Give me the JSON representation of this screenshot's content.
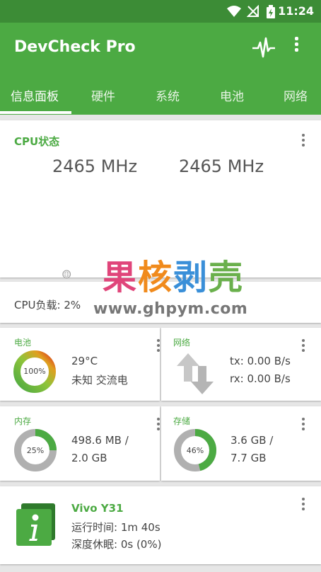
{
  "status_bar": {
    "time": "11:24"
  },
  "app": {
    "title": "DevCheck Pro"
  },
  "tabs": [
    {
      "label": "信息面板"
    },
    {
      "label": "硬件"
    },
    {
      "label": "系统"
    },
    {
      "label": "电池"
    },
    {
      "label": "网络"
    }
  ],
  "cpu_card": {
    "title": "CPU状态",
    "freq1": "2465 MHz",
    "freq2": "2465 MHz"
  },
  "cpu_load": {
    "label": "CPU负载: 2%"
  },
  "battery": {
    "title": "电池",
    "percent_label": "100%",
    "percent_value": 100,
    "temp": "29°C",
    "status": "未知 交流电"
  },
  "network": {
    "title": "网络",
    "tx": "tx: 0.00 B/s",
    "rx": "rx: 0.00 B/s"
  },
  "memory": {
    "title": "内存",
    "percent_label": "25%",
    "percent_value": 25,
    "line1": "498.6 MB /",
    "line2": "2.0 GB"
  },
  "storage": {
    "title": "存储",
    "percent_label": "46%",
    "percent_value": 46,
    "line1": "3.6 GB /",
    "line2": "7.7 GB"
  },
  "device": {
    "name": "Vivo Y31",
    "uptime": "运行时间: 1m 40s",
    "deep_sleep": "深度休眠: 0s (0%)"
  },
  "watermark": {
    "zh": "果核剥壳",
    "url": "www.ghpym.com"
  },
  "colors": {
    "primary": "#4caa43",
    "primary_dark": "#3c8c36",
    "ring_track": "#b0b0b0"
  }
}
